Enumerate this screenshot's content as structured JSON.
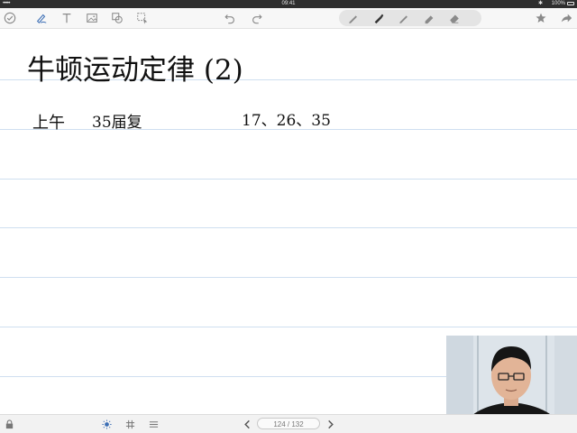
{
  "status_bar": {
    "signal": "•••••",
    "time": "09:41",
    "bluetooth": "✱",
    "battery": "100%"
  },
  "toolbar": {
    "left_tools": [
      "done-check-icon",
      "handwriting-tool-icon",
      "text-tool-icon",
      "image-tool-icon",
      "shape-tool-icon",
      "lasso-select-icon"
    ],
    "history": [
      "undo-icon",
      "redo-icon"
    ],
    "pens": [
      "pencil-icon",
      "fountain-pen-icon",
      "pen-icon",
      "highlighter-icon",
      "eraser-icon"
    ],
    "right_tools": [
      "favorite-star-icon",
      "share-icon"
    ]
  },
  "note": {
    "title": "牛顿运动定律 (2)",
    "line2_left": "上午",
    "line2_middle": "35届复",
    "line2_right": "17、26、35"
  },
  "bottom_bar": {
    "left_icons": [
      "lock-icon"
    ],
    "center_icons": [
      "brightness-icon",
      "grid-icon",
      "lines-icon"
    ],
    "page_indicator": "124 / 132"
  },
  "colors": {
    "ink": "#111111",
    "rule": "#cfdff0",
    "toolbar_bg": "#f7f7f7",
    "icon": "#8a8a8a"
  }
}
